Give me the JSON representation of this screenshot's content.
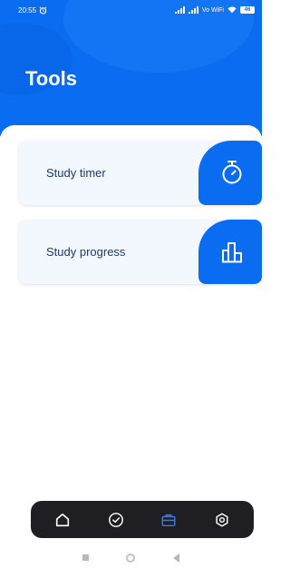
{
  "status_bar": {
    "time": "20:55",
    "network_label": "Vo WiFi",
    "battery": "46"
  },
  "header": {
    "title": "Tools"
  },
  "tools": [
    {
      "label": "Study timer",
      "icon": "stopwatch-icon"
    },
    {
      "label": "Study progress",
      "icon": "bar-chart-icon"
    }
  ],
  "nav": {
    "items": [
      {
        "name": "home-icon",
        "active": false
      },
      {
        "name": "check-circle-icon",
        "active": false
      },
      {
        "name": "toolbox-icon",
        "active": true
      },
      {
        "name": "settings-icon",
        "active": false
      }
    ]
  },
  "colors": {
    "primary": "#0a6cf0",
    "card_bg": "#f3f8fe",
    "label": "#1d3b6e",
    "nav_bg": "#1f1f23",
    "nav_active": "#2f7dfa"
  }
}
